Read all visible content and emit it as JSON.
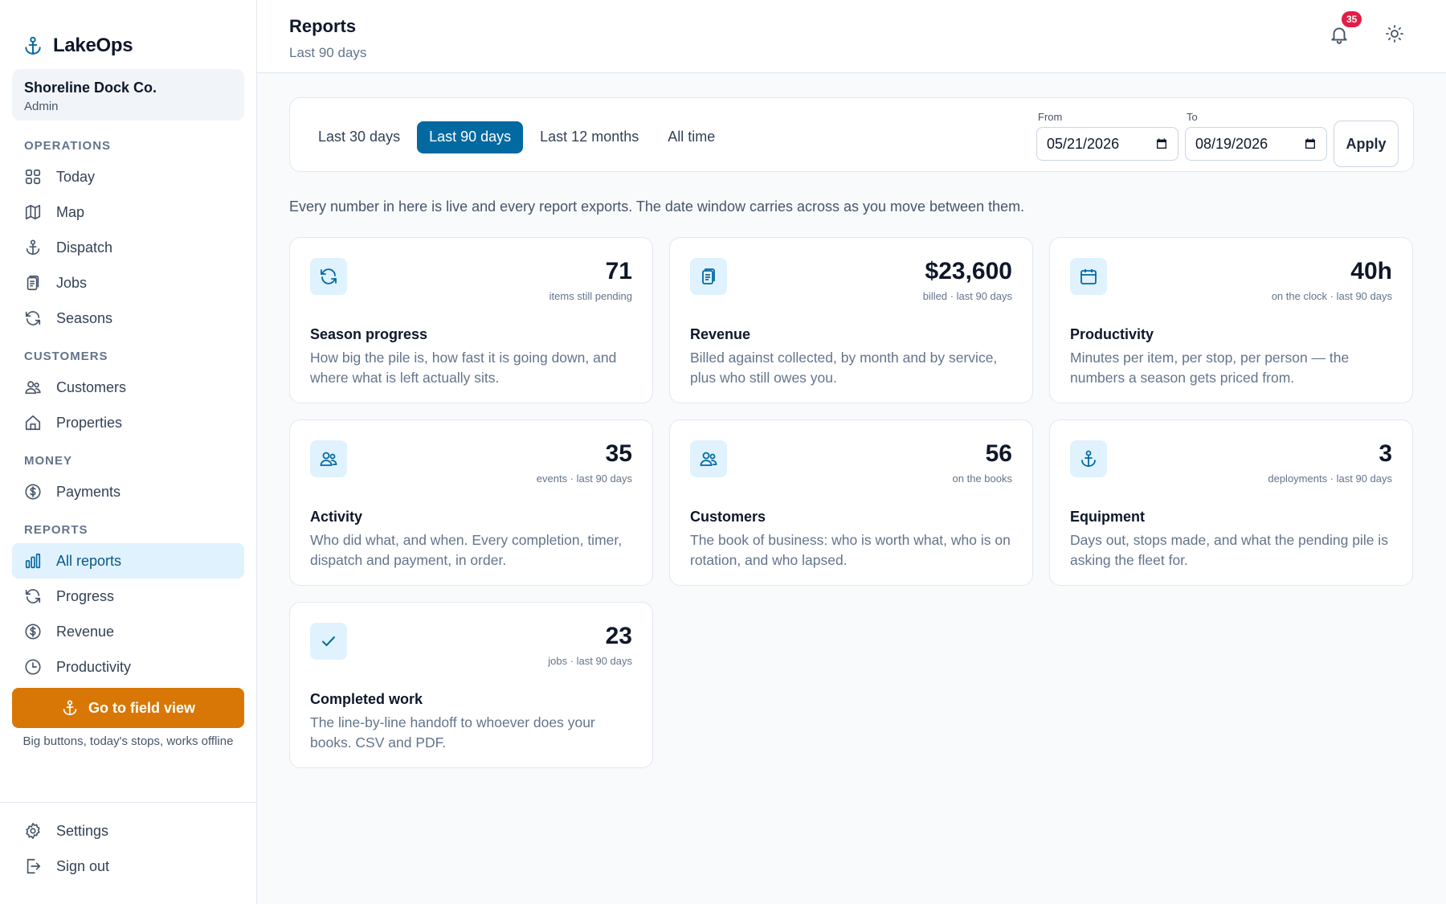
{
  "app": {
    "name": "LakeOps"
  },
  "org": {
    "name": "Shoreline Dock Co.",
    "role": "Admin"
  },
  "sidebar": {
    "sections": [
      {
        "label": "OPERATIONS",
        "items": [
          {
            "label": "Today",
            "icon": "grid-icon"
          },
          {
            "label": "Map",
            "icon": "map-icon"
          },
          {
            "label": "Dispatch",
            "icon": "anchor-icon"
          },
          {
            "label": "Jobs",
            "icon": "clipboard-icon"
          },
          {
            "label": "Seasons",
            "icon": "refresh-icon"
          }
        ]
      },
      {
        "label": "CUSTOMERS",
        "items": [
          {
            "label": "Customers",
            "icon": "users-icon"
          },
          {
            "label": "Properties",
            "icon": "home-icon"
          }
        ]
      },
      {
        "label": "MONEY",
        "items": [
          {
            "label": "Payments",
            "icon": "dollar-circle-icon"
          }
        ]
      },
      {
        "label": "REPORTS",
        "items": [
          {
            "label": "All reports",
            "icon": "bar-chart-icon",
            "active": true
          },
          {
            "label": "Progress",
            "icon": "refresh-icon"
          },
          {
            "label": "Revenue",
            "icon": "dollar-circle-icon"
          },
          {
            "label": "Productivity",
            "icon": "clock-icon"
          }
        ]
      }
    ],
    "field_button": "Go to field view",
    "field_hint": "Big buttons, today's stops, works offline",
    "footer": [
      {
        "label": "Settings",
        "icon": "gear-icon"
      },
      {
        "label": "Sign out",
        "icon": "sign-out-icon"
      }
    ]
  },
  "header": {
    "title": "Reports",
    "subtitle": "Last 90 days",
    "notification_count": "35"
  },
  "filters": {
    "ranges": [
      "Last 30 days",
      "Last 90 days",
      "Last 12 months",
      "All time"
    ],
    "selected_range": "Last 90 days",
    "from_label": "From",
    "from_value": "05/21/2026",
    "to_label": "To",
    "to_value": "08/19/2026",
    "apply_label": "Apply"
  },
  "intro": "Every number in here is live and every report exports. The date window carries across as you move between them.",
  "cards": [
    {
      "value": "71",
      "caption": "items still pending",
      "title": "Season progress",
      "desc": "How big the pile is, how fast it is going down, and where what is left actually sits.",
      "icon": "refresh-icon"
    },
    {
      "value": "$23,600",
      "caption": "billed · last 90 days",
      "title": "Revenue",
      "desc": "Billed against collected, by month and by service, plus who still owes you.",
      "icon": "clipboard-icon"
    },
    {
      "value": "40h",
      "caption": "on the clock · last 90 days",
      "title": "Productivity",
      "desc": "Minutes per item, per stop, per person — the numbers a season gets priced from.",
      "icon": "calendar-icon"
    },
    {
      "value": "35",
      "caption": "events · last 90 days",
      "title": "Activity",
      "desc": "Who did what, and when. Every completion, timer, dispatch and payment, in order.",
      "icon": "users-icon"
    },
    {
      "value": "56",
      "caption": "on the books",
      "title": "Customers",
      "desc": "The book of business: who is worth what, who is on rotation, and who lapsed.",
      "icon": "users-icon"
    },
    {
      "value": "3",
      "caption": "deployments · last 90 days",
      "title": "Equipment",
      "desc": "Days out, stops made, and what the pending pile is asking the fleet for.",
      "icon": "anchor-icon"
    },
    {
      "value": "23",
      "caption": "jobs · last 90 days",
      "title": "Completed work",
      "desc": "The line-by-line handoff to whoever does your books. CSV and PDF.",
      "icon": "check-icon"
    }
  ],
  "colors": {
    "accent": "#0369a1",
    "accent_light": "#e0f2fe",
    "field_button": "#d97706",
    "badge": "#e11d48"
  }
}
